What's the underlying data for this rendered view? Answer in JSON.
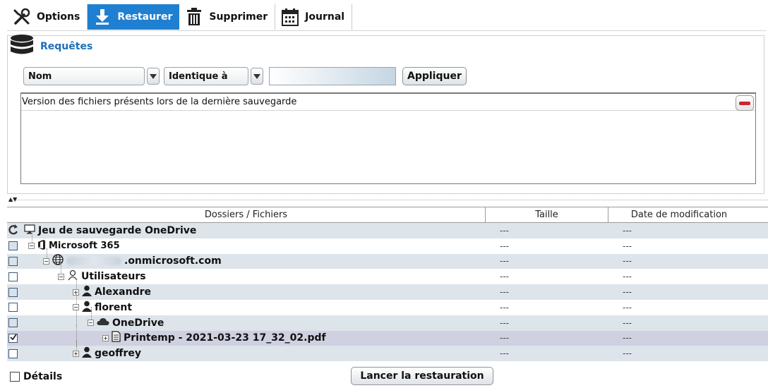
{
  "toolbar": {
    "buttons": [
      {
        "label": "Options",
        "icon": "tools-icon"
      },
      {
        "label": "Restaurer",
        "icon": "download-arrow-icon",
        "active": true
      },
      {
        "label": "Supprimer",
        "icon": "trash-icon"
      },
      {
        "label": "Journal",
        "icon": "calendar-icon"
      }
    ]
  },
  "queries": {
    "title": "Requêtes",
    "field_select": "Nom",
    "operator_select": "Identique à",
    "value": "",
    "apply_label": "Appliquer",
    "list": [
      "Version des fichiers présents lors de la dernière sauvegarde"
    ]
  },
  "table": {
    "headers": {
      "name": "Dossiers / Fichiers",
      "size": "Taille",
      "date": "Date de modification"
    },
    "rows": [
      {
        "label": "Jeu de sauvegarde OneDrive",
        "size": "---",
        "date": "---"
      },
      {
        "label": "Microsoft 365",
        "size": "---",
        "date": "---"
      },
      {
        "label": ".onmicrosoft.com",
        "size": "---",
        "date": "---"
      },
      {
        "label": "Utilisateurs",
        "size": "---",
        "date": "---"
      },
      {
        "label": "Alexandre",
        "size": "---",
        "date": "---"
      },
      {
        "label": "florent",
        "size": "---",
        "date": "---"
      },
      {
        "label": "OneDrive",
        "size": "---",
        "date": "---"
      },
      {
        "label": "Printemp - 2021-03-23 17_32_02.pdf",
        "size": "---",
        "date": "---",
        "checked": true
      },
      {
        "label": "geoffrey",
        "size": "---",
        "date": "---"
      }
    ]
  },
  "footer": {
    "details_label": "Détails",
    "launch_label": "Lancer la restauration"
  },
  "colors": {
    "accent": "#1f7fd0",
    "title_blue": "#1b6fb5",
    "row_alt": "#dde4ea",
    "row_selected": "#cfd0e0",
    "remove_red": "#d0242e"
  }
}
